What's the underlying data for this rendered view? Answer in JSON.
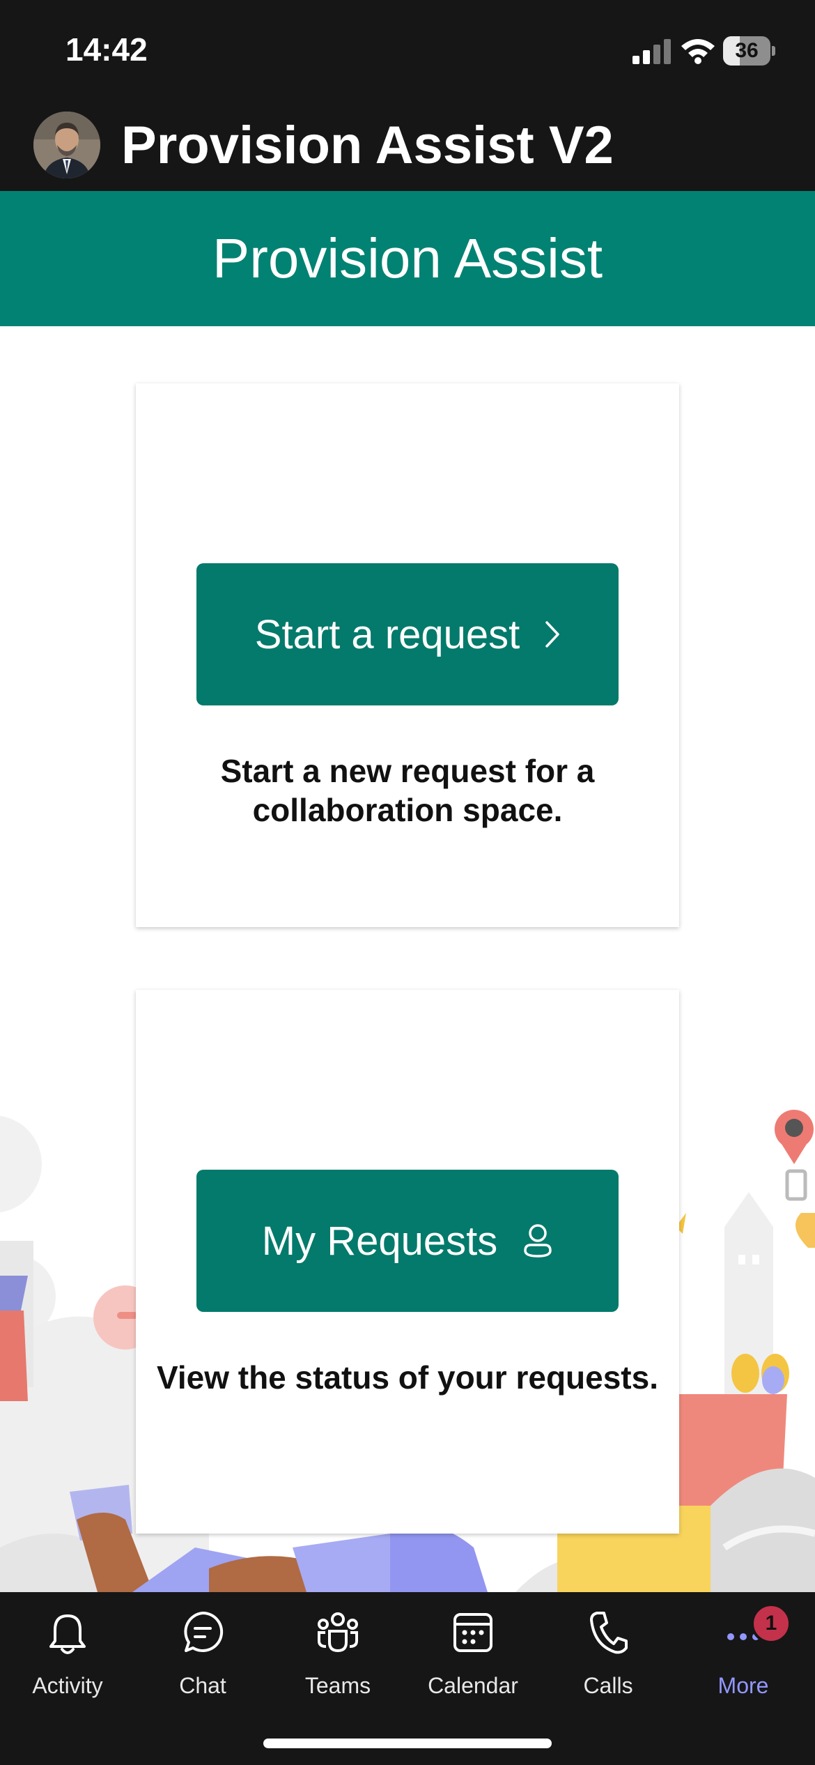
{
  "status_bar": {
    "time": "14:42",
    "battery": "36",
    "battery_level": 0.36
  },
  "app": {
    "title": "Provision Assist V2"
  },
  "banner": {
    "title": "Provision Assist"
  },
  "cards": [
    {
      "button_label": "Start a request",
      "button_icon": "chevron-right-icon",
      "description": "Start a new request for a collaboration space."
    },
    {
      "button_label": "My Requests",
      "button_icon": "person-icon",
      "description": "View the status of your requests."
    }
  ],
  "tabs": [
    {
      "label": "Activity",
      "icon": "bell-icon"
    },
    {
      "label": "Chat",
      "icon": "chat-icon"
    },
    {
      "label": "Teams",
      "icon": "teams-icon"
    },
    {
      "label": "Calendar",
      "icon": "calendar-icon"
    },
    {
      "label": "Calls",
      "icon": "phone-icon"
    },
    {
      "label": "More",
      "icon": "more-icon",
      "badge": "1",
      "active": true
    }
  ],
  "colors": {
    "teal": "#028272",
    "button": "#037a6b",
    "dark": "#161616",
    "active_tab": "#9297ff",
    "badge": "#c4314b"
  }
}
